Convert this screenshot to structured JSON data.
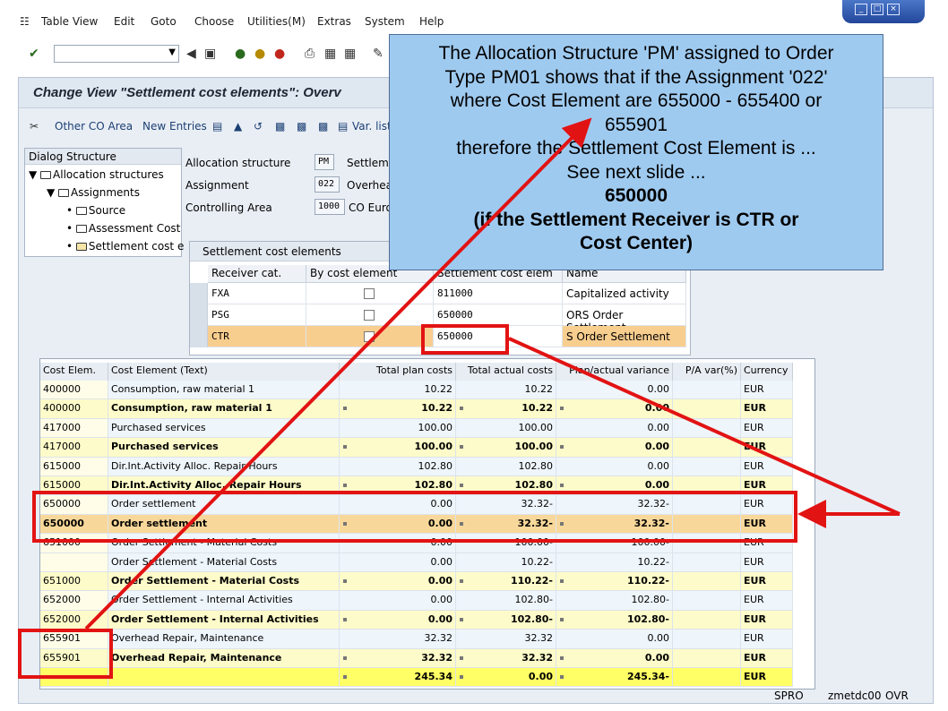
{
  "menu": {
    "items": [
      "Table View",
      "Edit",
      "Goto",
      "Choose",
      "Utilities(M)",
      "Extras",
      "System",
      "Help"
    ]
  },
  "title": "Change View \"Settlement cost elements\": Overv",
  "app_toolbar": {
    "other_co_area": "Other CO Area",
    "new_entries": "New Entries",
    "var_list": "Var. list"
  },
  "dialog_structure": {
    "header": "Dialog Structure",
    "nodes": [
      "Allocation structures",
      "Assignments",
      "Source",
      "Assessment Cost",
      "Settlement cost e"
    ]
  },
  "header_fields": {
    "allocation_structure_label": "Allocation structure",
    "allocation_structure_value": "PM",
    "allocation_structure_desc": "Settleme",
    "assignment_label": "Assignment",
    "assignment_value": "022",
    "assignment_desc": "Overhea",
    "controlling_area_label": "Controlling Area",
    "controlling_area_value": "1000",
    "controlling_area_desc": "CO Europ"
  },
  "settlement_table": {
    "caption": "Settlement cost elements",
    "columns": [
      "Receiver cat.",
      "By cost element",
      "Settlement cost elem",
      "Name"
    ],
    "rows": [
      {
        "cat": "FXA",
        "elem": "811000",
        "name": "Capitalized activity"
      },
      {
        "cat": "PSG",
        "elem": "650000",
        "name": "ORS Order Settlement"
      },
      {
        "cat": "CTR",
        "elem": "650000",
        "name": "S Order Settlement"
      }
    ]
  },
  "grid": {
    "columns": [
      "Cost Elem.",
      "Cost Element (Text)",
      "Total plan costs",
      "Total actual costs",
      "Plan/actual variance",
      "P/A var(%)",
      "Currency"
    ],
    "rows": [
      {
        "type": "plain",
        "elem": "400000",
        "text": "Consumption, raw material 1",
        "plan": "10.22",
        "actual": "10.22",
        "var": "0.00",
        "cur": "EUR"
      },
      {
        "type": "sub",
        "elem": "400000",
        "text": "Consumption, raw material 1",
        "plan": "10.22",
        "actual": "10.22",
        "var": "0.00",
        "cur": "EUR"
      },
      {
        "type": "plain",
        "elem": "417000",
        "text": "Purchased services",
        "plan": "100.00",
        "actual": "100.00",
        "var": "0.00",
        "cur": "EUR"
      },
      {
        "type": "sub",
        "elem": "417000",
        "text": "Purchased services",
        "plan": "100.00",
        "actual": "100.00",
        "var": "0.00",
        "cur": "EUR"
      },
      {
        "type": "plain",
        "elem": "615000",
        "text": "Dir.Int.Activity Alloc. Repair Hours",
        "plan": "102.80",
        "actual": "102.80",
        "var": "0.00",
        "cur": "EUR"
      },
      {
        "type": "sub",
        "elem": "615000",
        "text": "Dir.Int.Activity Alloc. Repair Hours",
        "plan": "102.80",
        "actual": "102.80",
        "var": "0.00",
        "cur": "EUR"
      },
      {
        "type": "plain",
        "elem": "650000",
        "text": "Order settlement",
        "plan": "0.00",
        "actual": "32.32-",
        "var": "32.32-",
        "cur": "EUR"
      },
      {
        "type": "sel",
        "elem": "650000",
        "text": "Order settlement",
        "plan": "0.00",
        "actual": "32.32-",
        "var": "32.32-",
        "cur": "EUR"
      },
      {
        "type": "plain",
        "elem": "651000",
        "text": "Order Settlement - Material Costs",
        "plan": "0.00",
        "actual": "100.00-",
        "var": "100.00-",
        "cur": "EUR"
      },
      {
        "type": "plain",
        "elem": "",
        "text": "Order Settlement - Material Costs",
        "plan": "0.00",
        "actual": "10.22-",
        "var": "10.22-",
        "cur": "EUR"
      },
      {
        "type": "sub",
        "elem": "651000",
        "text": "Order Settlement - Material Costs",
        "plan": "0.00",
        "actual": "110.22-",
        "var": "110.22-",
        "cur": "EUR"
      },
      {
        "type": "plain",
        "elem": "652000",
        "text": "Order Settlement - Internal Activities",
        "plan": "0.00",
        "actual": "102.80-",
        "var": "102.80-",
        "cur": "EUR"
      },
      {
        "type": "sub",
        "elem": "652000",
        "text": "Order Settlement - Internal Activities",
        "plan": "0.00",
        "actual": "102.80-",
        "var": "102.80-",
        "cur": "EUR"
      },
      {
        "type": "plain",
        "elem": "655901",
        "text": "Overhead Repair, Maintenance",
        "plan": "32.32",
        "actual": "32.32",
        "var": "0.00",
        "cur": "EUR"
      },
      {
        "type": "sub",
        "elem": "655901",
        "text": "Overhead Repair, Maintenance",
        "plan": "32.32",
        "actual": "32.32",
        "var": "0.00",
        "cur": "EUR"
      },
      {
        "type": "total",
        "elem": "",
        "text": "",
        "plan": "245.34",
        "actual": "0.00",
        "var": "245.34-",
        "cur": "EUR"
      }
    ]
  },
  "callout": {
    "lines": [
      "The Allocation Structure 'PM' assigned to Order",
      "Type PM01 shows that if the Assignment '022'",
      "where Cost Element are 655000 - 655400 or",
      "655901",
      "therefore the Settlement Cost Element is ...",
      "See next slide ...",
      "650000",
      "(if the Settlement Receiver is CTR or",
      "Cost Center)"
    ]
  },
  "statusbar": {
    "transaction": "SPRO",
    "system": "zmetdc00",
    "mode": "OVR"
  },
  "colors": {
    "annotation_red": "#e21313",
    "callout_bg": "#9fcaf0",
    "total_row": "#ffff66"
  }
}
